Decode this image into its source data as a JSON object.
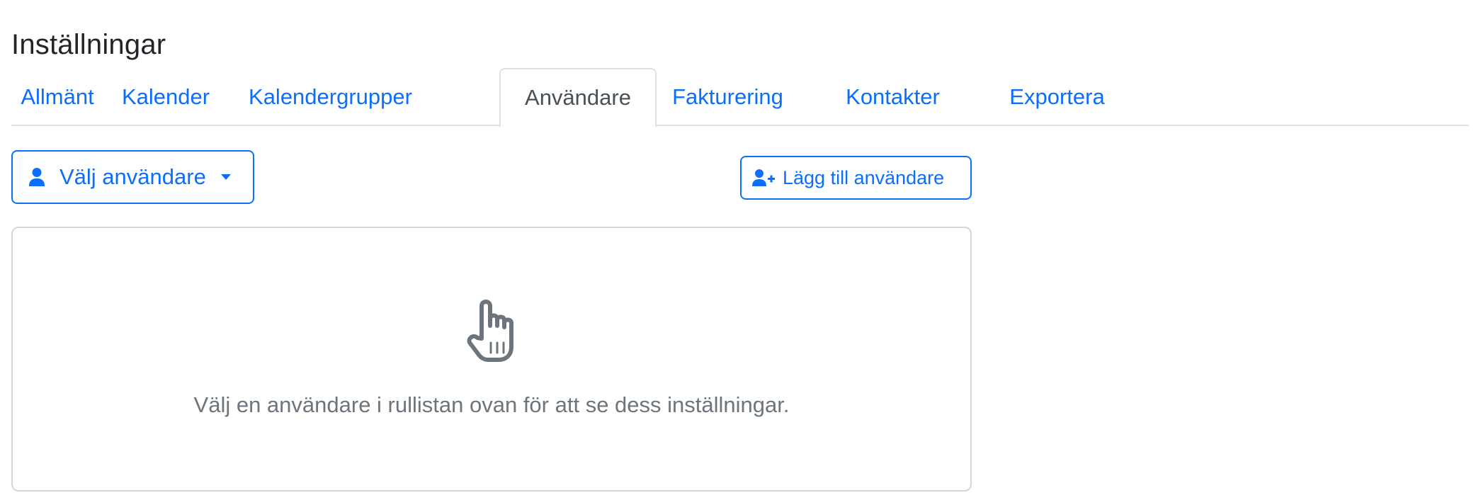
{
  "page": {
    "title": "Inställningar"
  },
  "tabs": [
    {
      "label": "Allmänt",
      "active": false
    },
    {
      "label": "Kalender",
      "active": false
    },
    {
      "label": "Kalendergrupper",
      "active": false
    },
    {
      "label": "Användare",
      "active": true
    },
    {
      "label": "Fakturering",
      "active": false
    },
    {
      "label": "Kontakter",
      "active": false
    },
    {
      "label": "Exportera",
      "active": false
    }
  ],
  "toolbar": {
    "select_user_label": "Välj användare",
    "add_user_label": "Lägg till användare"
  },
  "empty_state": {
    "message": "Välj en användare i rullistan ovan för att se dess inställningar."
  },
  "icons": {
    "select_user": "user-icon",
    "dropdown": "caret-down-icon",
    "add_user": "user-plus-icon",
    "empty_state": "pointing-hand-icon"
  },
  "colors": {
    "primary": "#0d6efd",
    "muted_text": "#6c757d",
    "border": "#dee2e6",
    "active_tab_text": "#495057",
    "heading_text": "#212529"
  }
}
